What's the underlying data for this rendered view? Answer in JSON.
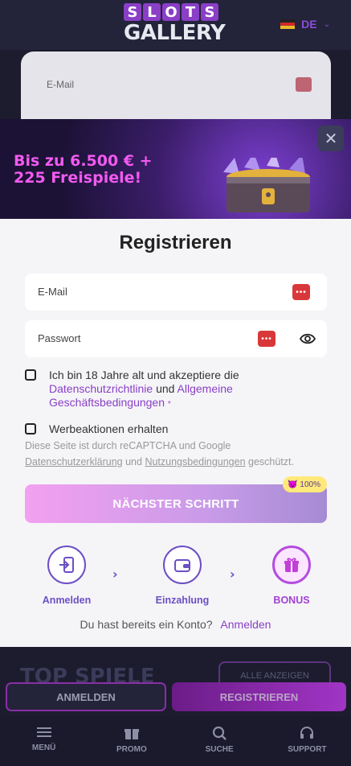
{
  "header": {
    "logo_top": "SLOTS",
    "logo_bottom": "GALLERY",
    "language": "DE"
  },
  "background_form": {
    "email_placeholder": "E-Mail"
  },
  "promo": {
    "line1": "Bis zu 6.500 € +",
    "line2": "225 Freispiele!"
  },
  "modal": {
    "title": "Registrieren",
    "email_placeholder": "E-Mail",
    "password_placeholder": "Passwort",
    "terms": {
      "prefix": "Ich bin 18 Jahre alt und akzeptiere die",
      "privacy_link": "Datenschutzrichtlinie",
      "and": "und",
      "terms_link": "Allgemeine Geschäftsbedingungen",
      "required_mark": "*"
    },
    "newsletter_label": "Werbeaktionen erhalten",
    "recaptcha": {
      "text1": "Diese Seite ist durch reCAPTCHA und Google",
      "privacy": "Datenschutzerklärung",
      "and": "und",
      "terms": "Nutzungsbedingungen",
      "suffix": "geschützt."
    },
    "next_button": "NÄCHSTER SCHRITT",
    "bonus_badge": "100%",
    "steps": [
      {
        "label": "Anmelden"
      },
      {
        "label": "Einzahlung"
      },
      {
        "label": "BONUS"
      }
    ],
    "have_account": "Du hast bereits ein Konto?",
    "login_link": "Anmelden"
  },
  "below": {
    "section_title": "TOP SPIELE",
    "show_all": "ALLE ANZEIGEN"
  },
  "auth_bar": {
    "login": "ANMELDEN",
    "register": "REGISTRIEREN"
  },
  "bottom_nav": [
    {
      "label": "MENÜ",
      "icon": "menu-icon"
    },
    {
      "label": "PROMO",
      "icon": "gift-icon"
    },
    {
      "label": "SUCHE",
      "icon": "search-icon"
    },
    {
      "label": "SUPPORT",
      "icon": "headset-icon"
    }
  ],
  "colors": {
    "accent": "#8a3fc6",
    "promo_text": "#f25af0",
    "dark_bg": "#1c1c2e"
  }
}
